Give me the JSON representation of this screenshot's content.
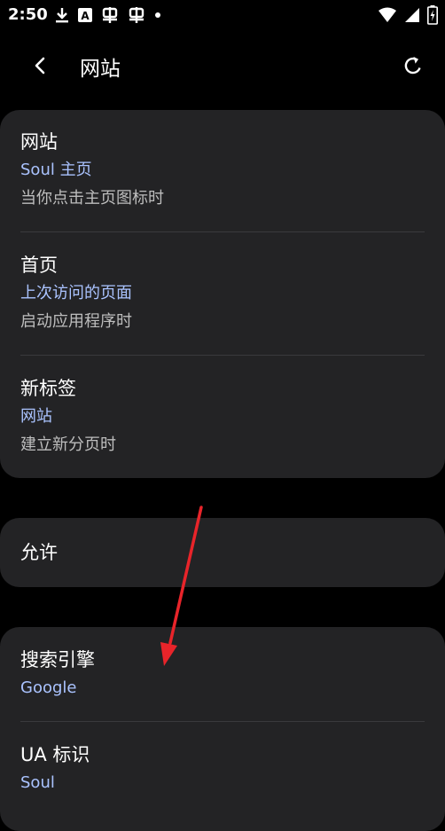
{
  "status_bar": {
    "time": "2:50",
    "left_icons": [
      "download-icon",
      "a-box-icon",
      "bug-icon",
      "bug-icon",
      "dot-icon"
    ],
    "right_icons": [
      "wifi-icon",
      "signal-icon",
      "battery-charging-icon"
    ]
  },
  "app_bar": {
    "title": "网站",
    "back_icon": "back-arrow-icon",
    "action_icon": "refresh-icon"
  },
  "card1": {
    "items": [
      {
        "title": "网站",
        "value": "Soul 主页",
        "desc": "当你点击主页图标时"
      },
      {
        "title": "首页",
        "value": "上次访问的页面",
        "desc": "启动应用程序时"
      },
      {
        "title": "新标签",
        "value": "网站",
        "desc": "建立新分页时"
      }
    ]
  },
  "card2": {
    "title": "允许"
  },
  "card3": {
    "items": [
      {
        "title": "搜索引擎",
        "value": "Google"
      },
      {
        "title": "UA 标识",
        "value": "Soul"
      }
    ]
  },
  "colors": {
    "background": "#000000",
    "card": "#232325",
    "accent_value": "#aac3ff",
    "secondary_text": "#bdbdbd",
    "annotation_arrow": "#e8242a"
  }
}
